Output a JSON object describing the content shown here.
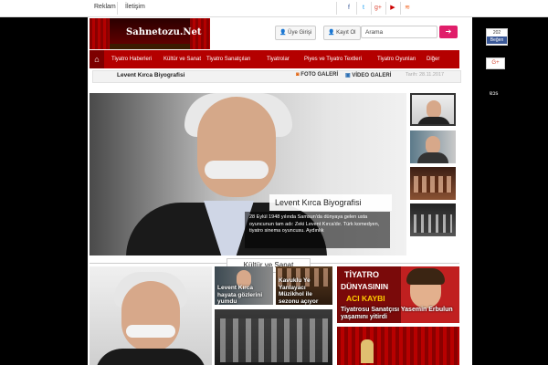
{
  "topbar": {
    "links": [
      "Reklam",
      "İletişim"
    ],
    "social_icons": [
      {
        "name": "facebook-icon",
        "glyph": "f",
        "color": "#3b5998"
      },
      {
        "name": "twitter-icon",
        "glyph": "t",
        "color": "#1da1f2"
      },
      {
        "name": "googleplus-icon",
        "glyph": "g+",
        "color": "#dd4b39"
      },
      {
        "name": "youtube-icon",
        "glyph": "▶",
        "color": "#cc0000"
      },
      {
        "name": "rss-icon",
        "glyph": "≋",
        "color": "#f26522"
      }
    ]
  },
  "header": {
    "logo_text": "Sahnetozu.Net",
    "member_login": "Üye Girişi",
    "register": "Kayıt Ol",
    "search_placeholder": "Arama"
  },
  "nav": {
    "home_icon": "home-icon",
    "items": [
      "Tiyatro Haberleri",
      "Kültür ve Sanat",
      "Tiyatro Sanatçıları",
      "Tiyatrolar",
      "Piyes ve Tiyatro Textleri",
      "Tiyatro Oyunları",
      "Diğer"
    ]
  },
  "breadcrumb": {
    "title": "Levent Kırca Biyografisi",
    "photo_gallery": "FOTO GALERİ",
    "video_gallery": "VİDEO GALERİ",
    "date": "Tarih: 28.11.2017"
  },
  "hero": {
    "title": "Levent Kırca Biyografisi",
    "description": "28 Eylül 1948 yılında Samsun'da dünyaya gelen usta oyuncunun tam adı: Zeki Levent Kırca'dır. Türk komedyen, tiyatro sinema oyuncusu. Aydınlık"
  },
  "section": {
    "title": "Kültür ve Sanat"
  },
  "grid": {
    "items": [
      {
        "caption": "Levent Kırca hayata gözlerini yumdu"
      },
      {
        "caption": "Kavuklu Ye Yanlayacı Müzikhol ile sezonu açıyor"
      },
      {
        "caption": "Tiyatrosu Sanatçısı Yasemin Erbulun yaşamını yitirdi"
      }
    ],
    "poster_text": [
      "TİYATRO",
      "DÜNYASININ",
      "ACI KAYBI"
    ]
  },
  "sidebar": {
    "fb_count": "202",
    "fb_label": "Beğen",
    "gplus_label": "G+",
    "side_label": "ɐɔs"
  },
  "colors": {
    "nav": "#b40000",
    "accent": "#e01e6a"
  }
}
